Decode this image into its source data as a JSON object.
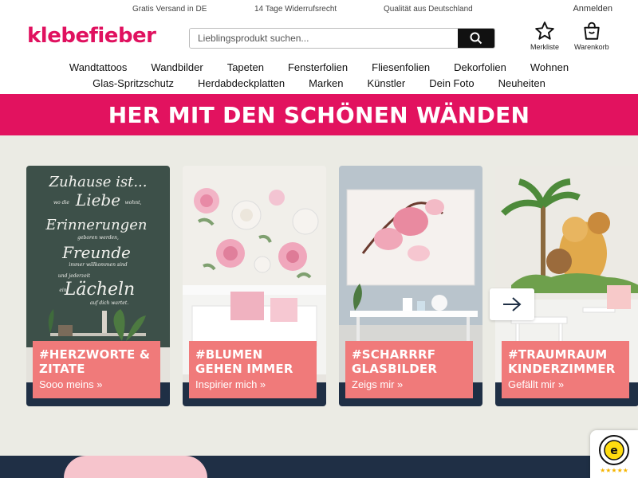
{
  "topbar": {
    "usps": [
      "Gratis Versand in DE",
      "14 Tage Widerrufsrecht",
      "Qualität aus Deutschland"
    ],
    "login": "Anmelden"
  },
  "header": {
    "logo": "klebefieber",
    "search_placeholder": "Lieblingsprodukt suchen...",
    "wishlist": "Merkliste",
    "cart": "Warenkorb"
  },
  "nav": {
    "row1": [
      "Wandtattoos",
      "Wandbilder",
      "Tapeten",
      "Fensterfolien",
      "Fliesenfolien",
      "Dekorfolien",
      "Wohnen"
    ],
    "row2": [
      "Glas-Spritzschutz",
      "Herdabdeckplatten",
      "Marken",
      "Künstler",
      "Dein Foto",
      "Neuheiten"
    ]
  },
  "banner": {
    "title": "HER MIT DEN SCHÖNEN WÄNDEN"
  },
  "cards": [
    {
      "title": "#HERZWORTE & ZITATE",
      "cta": "Sooo meins »",
      "quote": [
        "Zuhause ist...",
        "wo die",
        "Liebe",
        "wohnt,",
        "Erinnerungen",
        "geboren werden,",
        "Freunde",
        "immer willkommen sind",
        "und jederzeit",
        "ein",
        "Lächeln",
        "auf dich wartet."
      ]
    },
    {
      "title": "#BLUMEN GEHEN IMMER",
      "cta": "Inspirier mich »"
    },
    {
      "title": "#SCHARRRF GLASBILDER",
      "cta": "Zeigs mir »"
    },
    {
      "title": "#TRAUMRAUM KINDERZIMMER",
      "cta": "Gefällt mir »"
    }
  ],
  "trust": {
    "stars": "★★★★★"
  },
  "colors": {
    "brand": "#e0115f",
    "banner": "#e2125f",
    "label": "#f07a7a",
    "navy": "#1f2f45",
    "stage": "#ebebe4"
  },
  "icons": {
    "search": "search-icon",
    "wishlist": "star-icon",
    "cart": "bag-icon",
    "next": "arrow-right-icon"
  }
}
